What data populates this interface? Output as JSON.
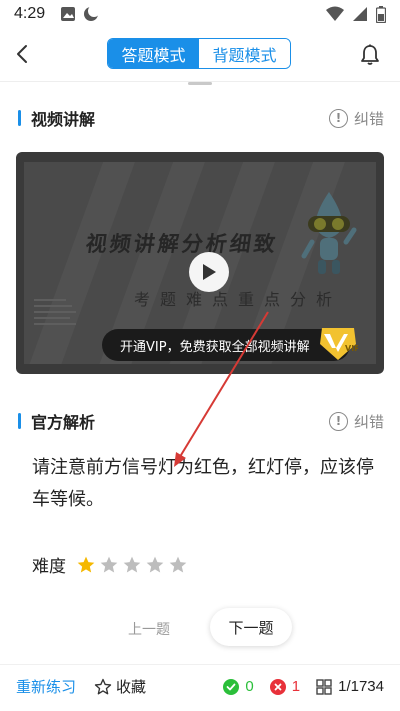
{
  "status_bar": {
    "time": "4:29"
  },
  "header": {
    "tabs": [
      {
        "label": "答题模式",
        "active": true
      },
      {
        "label": "背题模式",
        "active": false
      }
    ]
  },
  "video_section": {
    "title": "视频讲解",
    "report_label": "纠错",
    "video": {
      "headline": "视频讲解分析细致",
      "subline": "考题难点重点分析",
      "vip_banner": "开通VIP，免费获取全部视频讲解",
      "vip_badge": "VIP"
    }
  },
  "analysis_section": {
    "title": "官方解析",
    "report_label": "纠错",
    "text": "请注意前方信号灯为红色，红灯停，应该停车等候。"
  },
  "difficulty": {
    "label": "难度",
    "rating": 1,
    "max": 5
  },
  "navigation": {
    "prev_label": "上一题",
    "next_label": "下一题"
  },
  "bottom_bar": {
    "retry_label": "重新练习",
    "favorite_label": "收藏",
    "correct_count": "0",
    "wrong_count": "1",
    "progress": "1/1734"
  },
  "colors": {
    "accent": "#1a8fe8",
    "correct": "#2bbf3a",
    "wrong": "#e8313a",
    "star_active": "#f5b800",
    "star_inactive": "#bdbdbd",
    "annotation_arrow": "#d63a35"
  }
}
